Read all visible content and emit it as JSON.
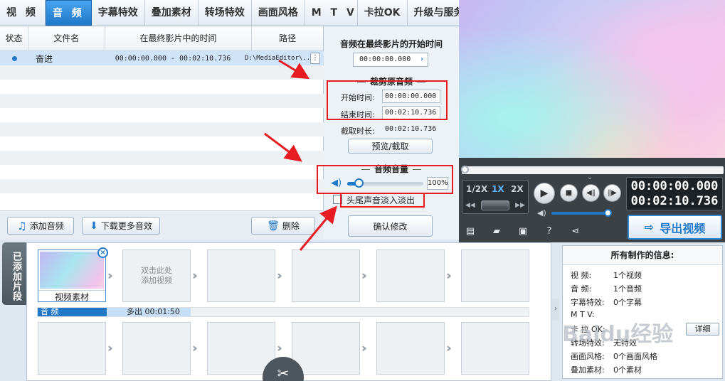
{
  "tabs": [
    "视 频",
    "音 频",
    "字幕特效",
    "叠加素材",
    "转场特效",
    "画面风格",
    "M T V",
    "卡拉OK",
    "升级与服务"
  ],
  "audio_list": {
    "columns": [
      "状态",
      "文件名",
      "在最终影片中的时间",
      "路径"
    ],
    "rows": [
      {
        "name": "奋进",
        "time": "00:00:00.000 - 00:02:10.736",
        "path": "D:\\MediaEditor\\..",
        "selected": true
      }
    ],
    "more_icon": "ellipsis-icon"
  },
  "list_buttons": {
    "add": "添加音频",
    "download": "下载更多音效",
    "delete": "删除"
  },
  "settings": {
    "start_title": "音频在最终影片的开始时间",
    "start_time": "00:00:00.000",
    "crop_title": "裁剪原音频",
    "start_label": "开始时间:",
    "start_value": "00:00:00.000",
    "end_label": "结束时间:",
    "end_value": "00:02:10.736",
    "duration_label": "截取时长:",
    "duration_value": "00:02:10.736",
    "preview_button": "预览/截取",
    "volume_title": "音频音量",
    "volume_value": "100%",
    "volume_level": 0.15,
    "fade_label": "头尾声音淡入淡出",
    "fade_checked": false,
    "confirm_button": "确认修改"
  },
  "player": {
    "speeds": [
      "1/2X",
      "1X",
      "2X"
    ],
    "active_speed": "1X",
    "current_time": "00:00:00.000",
    "total_time": "00:02:10.736",
    "export_button": "导出视频",
    "volume_level": 0.95
  },
  "timeline": {
    "side_label": "已添加片段",
    "first_clip_label": "视频素材",
    "add_hint": "双击此处\n添加视频",
    "audio_label": "音 频",
    "audio_clip_text": "多出 00:01:50"
  },
  "info": {
    "title": "所有制作的信息:",
    "items": [
      {
        "k": "视     频:",
        "v": "1个视频"
      },
      {
        "k": "音     频:",
        "v": "1个音频"
      },
      {
        "k": "字幕特效:",
        "v": "0个字幕"
      },
      {
        "k": "M   T   V:",
        "v": ""
      },
      {
        "k": "卡 拉 OK:",
        "v": ""
      },
      {
        "k": "转场特效:",
        "v": "无特效"
      },
      {
        "k": "画面风格:",
        "v": "0个画面风格"
      },
      {
        "k": "叠加素材:",
        "v": "0个素材"
      }
    ],
    "detail_button": "详细"
  },
  "watermark": "Baidu经验",
  "colors": {
    "accent": "#1f78c8",
    "highlight": "#e81b22"
  }
}
